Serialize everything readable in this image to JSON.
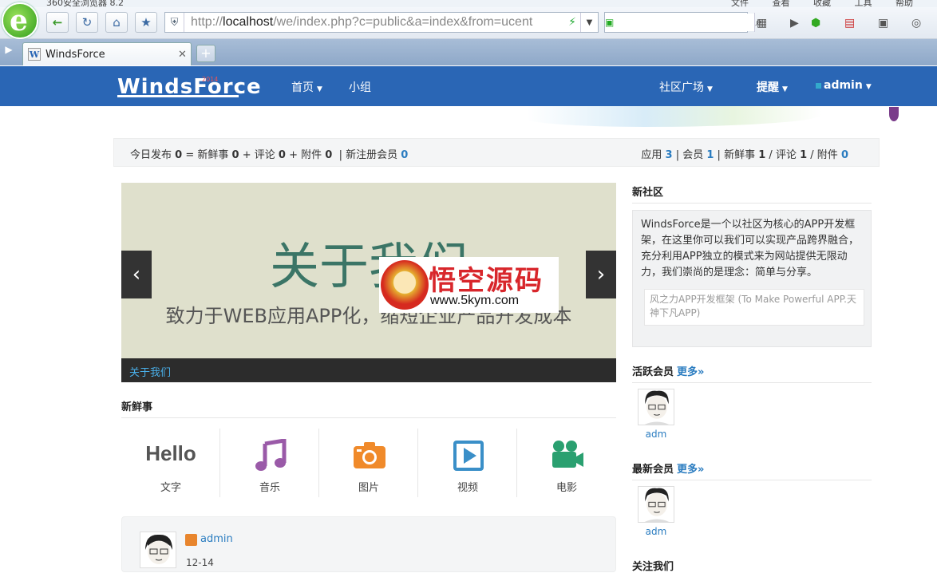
{
  "browser": {
    "window_title": "360安全浏览器 8.2",
    "menu_items": [
      "文件",
      "查看",
      "收藏",
      "工具",
      "帮助"
    ],
    "address": {
      "prefix": "http://",
      "host": "localhost",
      "path": "/we/index.php?c=public&a=index&from=ucent"
    },
    "search_value": "",
    "tab_title": "WindsForce",
    "new_tab_label": "+"
  },
  "site": {
    "brand": "WindsForce",
    "brand_year": "2014",
    "nav_left": [
      "首页",
      "小组"
    ],
    "nav_right": [
      "社区广场",
      "提醒",
      "admin"
    ]
  },
  "stats": {
    "today": {
      "label": "今日发布",
      "total": "0",
      "eq": "=",
      "fresh_label": "新鲜事",
      "fresh": "0",
      "comment_label": "评论",
      "comment": "0",
      "attach_label": "附件",
      "attach": "0",
      "newmember_label": "新注册会员",
      "newmember": "0"
    },
    "totals": {
      "app_label": "应用",
      "app": "3",
      "member_label": "会员",
      "member": "1",
      "fresh_label": "新鲜事",
      "fresh": "1",
      "comment_label": "评论",
      "comment": "1",
      "attach_label": "附件",
      "attach": "0"
    }
  },
  "slider": {
    "heading": "关于我们",
    "subheading": "致力于WEB应用APP化，缩短企业产品开发成本",
    "caption": "关于我们",
    "prev": "‹",
    "next": "›"
  },
  "watermark": {
    "title": "悟空源码",
    "url": "www.5kym.com"
  },
  "fresh": {
    "heading": "新鲜事",
    "items": [
      {
        "label": "文字",
        "icon": "hello-text-icon",
        "glyph": "Hello"
      },
      {
        "label": "音乐",
        "icon": "music-icon"
      },
      {
        "label": "图片",
        "icon": "camera-icon"
      },
      {
        "label": "视频",
        "icon": "video-play-icon"
      },
      {
        "label": "电影",
        "icon": "movie-camera-icon"
      }
    ]
  },
  "post": {
    "author": "admin",
    "date": "12-14"
  },
  "sidebar": {
    "new_community": {
      "heading": "新社区",
      "text": "WindsForce是一个以社区为核心的APP开发框架，在这里你可以我们可以实现产品跨界融合，充分利用APP独立的模式来为网站提供无限动力，我们崇尚的是理念：简单与分享。",
      "motto": "风之力APP开发框架 (To Make Powerful APP.天神下凡APP)"
    },
    "active_members": {
      "heading": "活跃会员",
      "more": "更多»",
      "members": [
        "adm"
      ]
    },
    "new_members": {
      "heading": "最新会员",
      "more": "更多»",
      "members": [
        "adm"
      ]
    },
    "follow": {
      "heading": "关注我们"
    }
  },
  "colors": {
    "nav_blue": "#2a66b5",
    "link_blue": "#2a7cc0",
    "music_purple": "#9a5aa8",
    "camera_orange": "#f08a2a",
    "video_blue": "#3a8fc8",
    "movie_green": "#2aa070"
  }
}
